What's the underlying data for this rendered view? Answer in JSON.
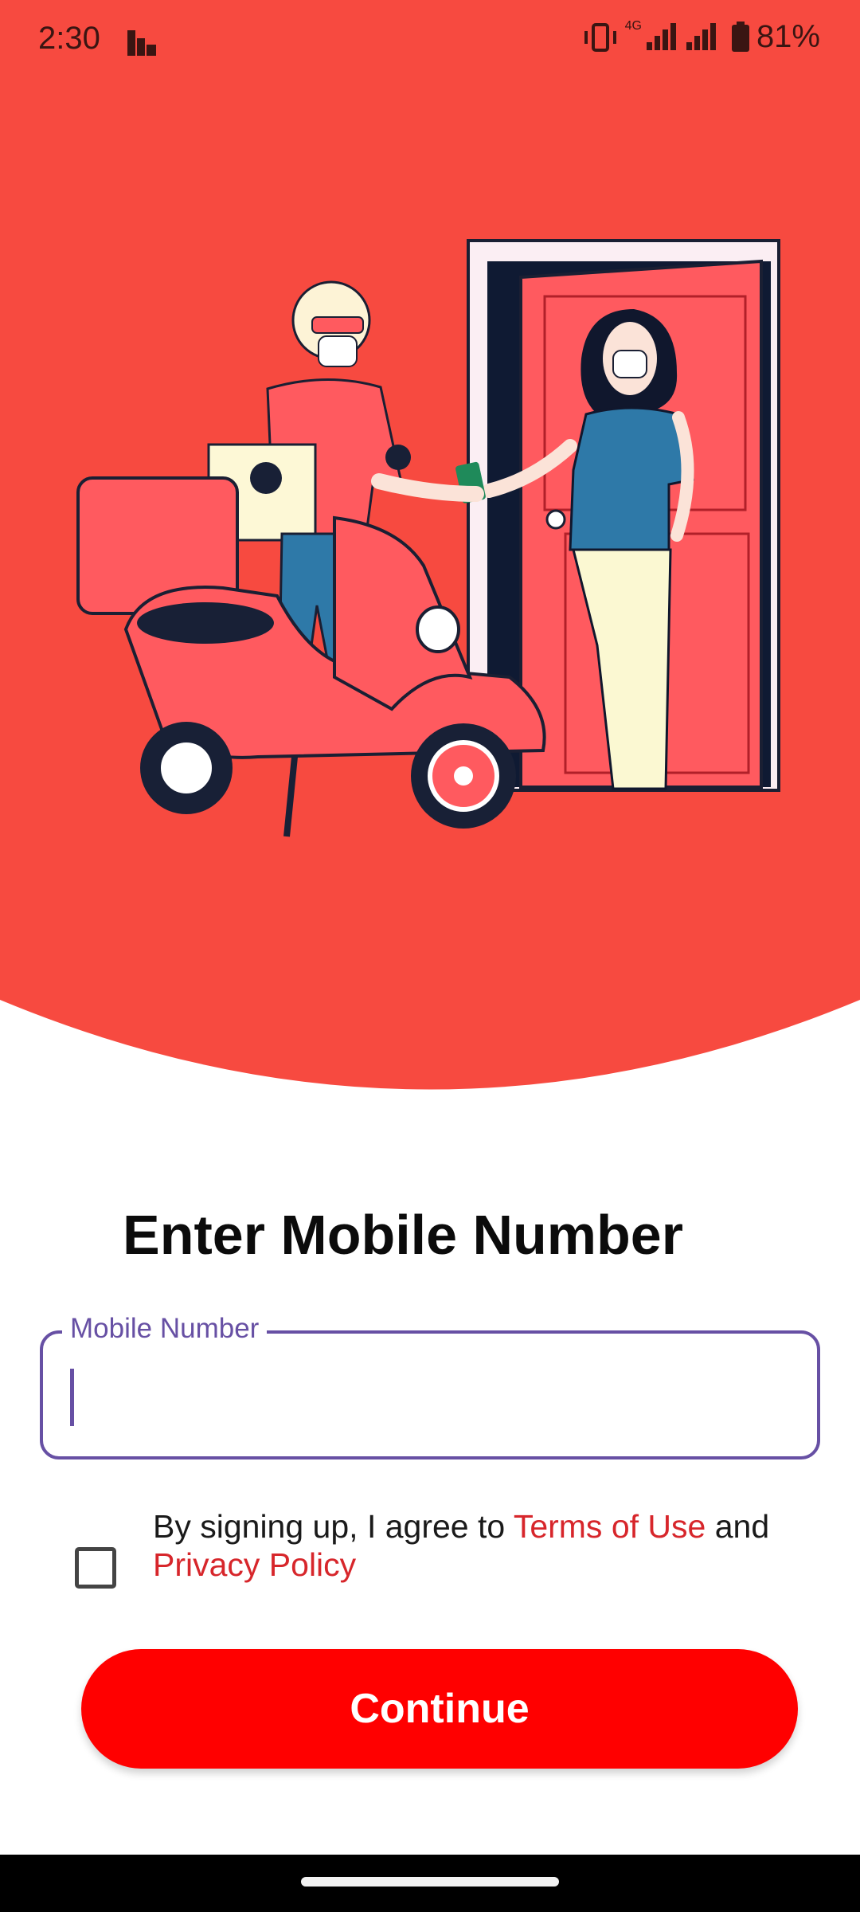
{
  "status_bar": {
    "time": "2:30",
    "battery": "81%",
    "network": "4G",
    "icons": [
      "activity-bars-icon",
      "vibrate-icon",
      "signal-icon",
      "battery-icon"
    ]
  },
  "hero": {
    "background_color": "#f74a40",
    "illustration": "delivery-scooter-illustration"
  },
  "login": {
    "title": "Enter Mobile Number",
    "field_label": "Mobile Number",
    "field_value": "",
    "terms_prefix": "By signing up, I agree to ",
    "terms_link": "Terms of Use",
    "terms_middle": " and ",
    "privacy_link": "Privacy Policy",
    "checkbox_checked": false,
    "continue_label": "Continue"
  },
  "colors": {
    "accent": "#ff0000",
    "link": "#d7262b",
    "field_border": "#6750a4"
  }
}
